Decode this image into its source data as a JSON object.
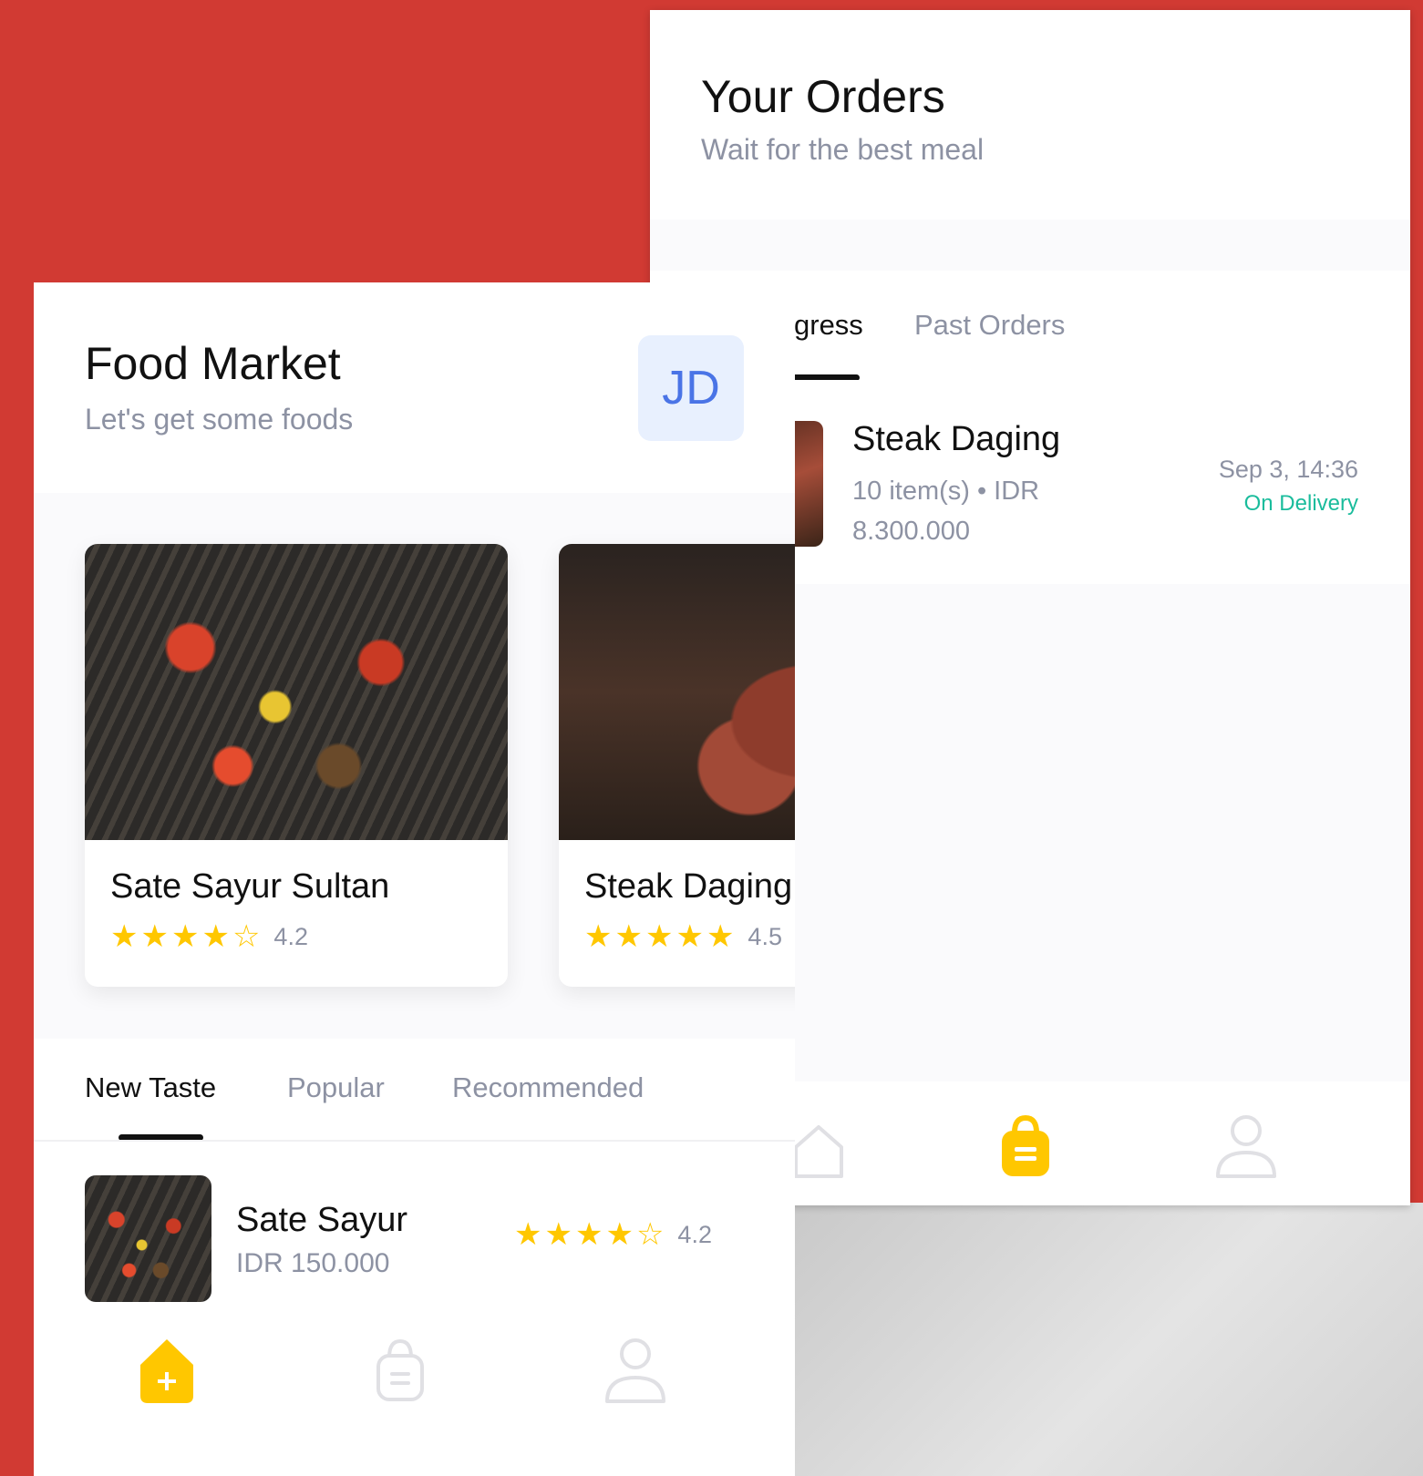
{
  "orders_screen": {
    "title": "Your Orders",
    "subtitle": "Wait for the best meal",
    "tabs": [
      {
        "label": "In Progress",
        "visible_label": "gress",
        "active": true
      },
      {
        "label": "Past Orders",
        "active": false
      }
    ],
    "order": {
      "name": "Steak Daging",
      "items": "10 item(s) • IDR 8.300.000",
      "date": "Sep 3, 14:36",
      "status": "On Delivery",
      "status_color": "#1abc9c"
    },
    "bottom_nav": [
      {
        "icon": "home-icon",
        "active": false
      },
      {
        "icon": "shopping-bag-icon",
        "active": true
      },
      {
        "icon": "user-icon",
        "active": false
      }
    ]
  },
  "market_screen": {
    "title": "Food Market",
    "subtitle": "Let's get some foods",
    "avatar_initials": "JD",
    "featured": [
      {
        "name": "Sate Sayur Sultan",
        "rating": 4.2,
        "stars_filled": 4,
        "rating_text": "4.2"
      },
      {
        "name": "Steak Daging",
        "rating": 4.5,
        "stars_filled": 5,
        "rating_text": "4.5"
      }
    ],
    "tabs": [
      {
        "label": "New Taste",
        "active": true
      },
      {
        "label": "Popular",
        "active": false
      },
      {
        "label": "Recommended",
        "active": false
      }
    ],
    "list": [
      {
        "name": "Sate Sayur",
        "price": "IDR 150.000",
        "rating": 4.2,
        "stars_filled": 4,
        "rating_text": "4.2"
      }
    ],
    "bottom_nav": [
      {
        "icon": "home-icon",
        "active": true
      },
      {
        "icon": "shopping-bag-icon",
        "active": false
      },
      {
        "icon": "user-icon",
        "active": false
      }
    ]
  },
  "colors": {
    "background": "#d13a33",
    "accent": "#ffc700",
    "text_primary": "#111111",
    "text_secondary": "#8d92a3",
    "avatar_bg": "#e8f0fe",
    "avatar_text": "#4a74e6"
  }
}
